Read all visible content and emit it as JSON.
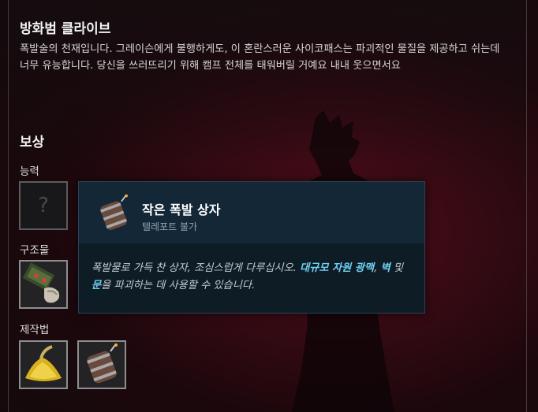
{
  "quest": {
    "title": "방화범 클라이브",
    "description": "폭발술의 천재입니다. 그레이슨에게 불행하게도, 이 혼란스러운 사이코패스는 파괴적인 물질을 제공하고 쉬는데 너무 유능합니다. 당신을 쓰러뜨리기 위해 캠프 전체를 태워버릴 거예요 내내 웃으면서요"
  },
  "rewards": {
    "heading": "보상",
    "ability_label": "능력",
    "ability_unknown_glyph": "?",
    "structure_label": "구조물",
    "recipe_label": "제작법"
  },
  "tooltip": {
    "name": "작은 폭발 상자",
    "subtitle": "텔레포트 불가",
    "text_1": "폭발물로 가득 찬 상자, 조심스럽게 다루십시오. ",
    "highlight_1": "대규모 자원 광맥",
    "text_2": ", ",
    "highlight_2": "벽",
    "text_3": " 및 ",
    "highlight_3": "문",
    "text_4": "을 파괴하는 데 사용할 수 있습니다."
  },
  "icons": {
    "ability": "unknown-question-icon",
    "structure": "explosive-crate-structure-icon",
    "recipe_1": "sulfur-powder-pile-icon",
    "recipe_2": "explosive-barrel-icon",
    "tooltip": "explosive-barrel-icon"
  },
  "colors": {
    "highlight": "#6fd0f2",
    "tooltip_bg": "#0e1c26",
    "background_accent": "#5a0d1a"
  }
}
